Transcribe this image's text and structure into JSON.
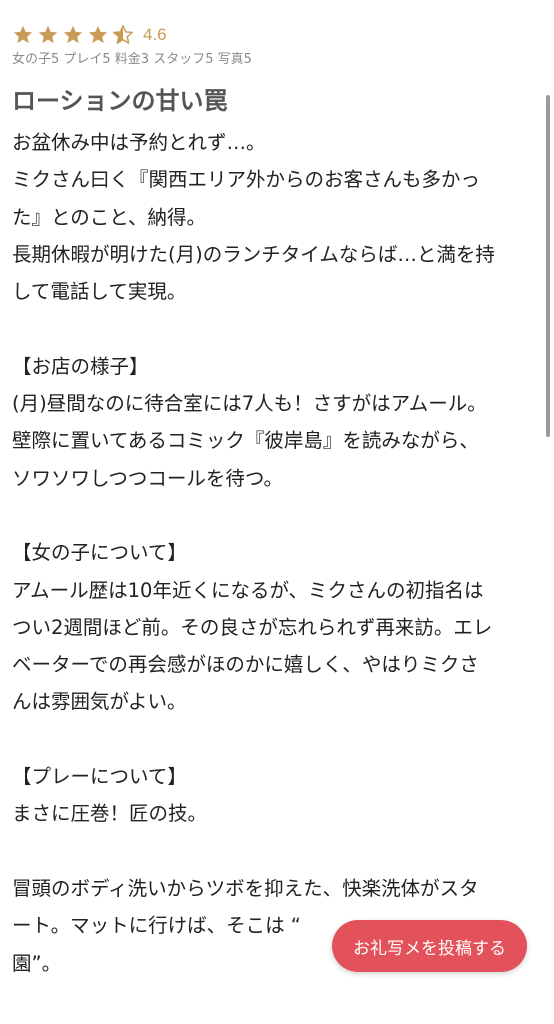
{
  "rating": {
    "stars": 4.5,
    "value": "4.6",
    "star_color": "#c99b55",
    "icons": [
      "star-full-icon",
      "star-full-icon",
      "star-full-icon",
      "star-full-icon",
      "star-half-icon"
    ]
  },
  "scores": "女の子5 プレイ5 料金3 スタッフ5 写真5",
  "review": {
    "title": "ローションの甘い罠",
    "lines": [
      "お盆休み中は予約とれず…。",
      "ミクさん曰く『関西エリア外からのお客さんも多かっ",
      "た』とのこと、納得。",
      "長期休暇が明けた(月)のランチタイムならば…と満を持",
      "して電話して実現。",
      "",
      "【お店の様子】",
      "(月)昼間なのに待合室には7人も！さすがはアムール。",
      "壁際に置いてあるコミック『彼岸島』を読みながら、",
      "ソワソワしつつコールを待つ。",
      "",
      "【女の子について】",
      "アムール歴は10年近くになるが、ミクさんの初指名は",
      "つい2週間ほど前。その良さが忘れられず再来訪。エレ",
      "ベーターでの再会感がほのかに嬉しく、やはりミクさ",
      "んは雰囲気がよい。",
      "",
      "【プレーについて】",
      "まさに圧巻！匠の技。",
      "",
      "冒頭のボディ洗いからツボを抑えた、快楽洗体がスタ",
      "ート。マットに行けば、そこは “",
      "園”。"
    ]
  },
  "fab": {
    "label": "お礼写メを投稿する",
    "color": "#e3525a"
  }
}
